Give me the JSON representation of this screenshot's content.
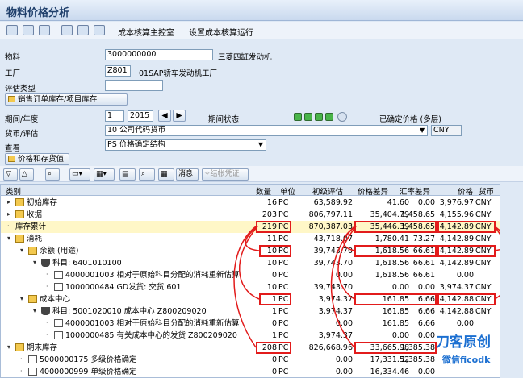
{
  "window": {
    "title": "物料价格分析"
  },
  "toolbar": {
    "master_label": "成本核算主控室",
    "settings_label": "设置成本核算运行"
  },
  "form": {
    "material_label": "物料",
    "material_value": "3000000000",
    "material_desc": "三菱四缸发动机",
    "plant_label": "工厂",
    "plant_value": "Z801",
    "plant_desc": "01SAP轿车发动机工厂",
    "valuation_type_label": "评估类型",
    "valuation_type_value": "",
    "sales_order_button": "销售订单库存/项目库存",
    "period_label": "期间/年度",
    "period_value": "1",
    "year_value": "2015",
    "period_status_label": "期间状态",
    "period_status_text": "已确定价格 (多层)",
    "currency_label": "货币/评估",
    "currency_value": "10 公司代码货币",
    "currency_code": "CNY",
    "view_label": "查看",
    "view_value": "PS 价格确定结构",
    "price_stock_button": "价格和存货值"
  },
  "gridbar": {
    "message_label": "消息",
    "close_voucher_label": "结帐凭证"
  },
  "columns": {
    "category": "类别",
    "quantity": "数量",
    "unit": "单位",
    "initial": "初级评估",
    "price_diff": "价格差异",
    "fx_diff": "汇率差异",
    "price": "价格",
    "currency": "货币"
  },
  "rows": [
    {
      "name": "初始库存",
      "qty": "16",
      "unit": "PC",
      "initial": "63,589.92",
      "price_diff": "41.60",
      "fx_diff": "0.00",
      "price": "3,976.97",
      "cur": "CNY"
    },
    {
      "name": "收据",
      "qty": "203",
      "unit": "PC",
      "initial": "806,797.11",
      "price_diff": "35,404.79",
      "fx_diff": "1,458.65",
      "price": "4,155.96",
      "cur": "CNY"
    },
    {
      "name": "库存累计",
      "qty": "219",
      "unit": "PC",
      "initial": "870,387.03",
      "price_diff": "35,446.39",
      "fx_diff": "1,458.65",
      "price": "4,142.89",
      "cur": "CNY"
    },
    {
      "name": "消耗",
      "qty": "11",
      "unit": "PC",
      "initial": "43,718.07",
      "price_diff": "1,780.41",
      "fx_diff": "73.27",
      "price": "4,142.89",
      "cur": "CNY"
    },
    {
      "name": "余额 (用途)",
      "qty": "10",
      "unit": "PC",
      "initial": "39,743.70",
      "price_diff": "1,618.56",
      "fx_diff": "66.61",
      "price": "4,142.89",
      "cur": "CNY"
    },
    {
      "name": "科目: 6401010100",
      "qty": "10",
      "unit": "PC",
      "initial": "39,743.70",
      "price_diff": "1,618.56",
      "fx_diff": "66.61",
      "price": "4,142.89",
      "cur": "CNY"
    },
    {
      "name": "4000001003 相对于原始科目分配的消耗重新估算",
      "qty": "0",
      "unit": "PC",
      "initial": "0.00",
      "price_diff": "1,618.56",
      "fx_diff": "66.61",
      "price": "0.00",
      "cur": ""
    },
    {
      "name": "1000000484 GD发货: 交货 601",
      "qty": "10",
      "unit": "PC",
      "initial": "39,743.70",
      "price_diff": "0.00",
      "fx_diff": "0.00",
      "price": "3,974.37",
      "cur": "CNY"
    },
    {
      "name": "成本中心",
      "qty": "1",
      "unit": "PC",
      "initial": "3,974.37",
      "price_diff": "161.85",
      "fx_diff": "6.66",
      "price": "4,142.88",
      "cur": "CNY"
    },
    {
      "name": "科目: 5001020010 成本中心 Z800209020",
      "qty": "1",
      "unit": "PC",
      "initial": "3,974.37",
      "price_diff": "161.85",
      "fx_diff": "6.66",
      "price": "4,142.88",
      "cur": "CNY"
    },
    {
      "name": "4000001003 相对于原始科目分配的消耗重新估算",
      "qty": "0",
      "unit": "PC",
      "initial": "0.00",
      "price_diff": "161.85",
      "fx_diff": "6.66",
      "price": "0.00",
      "cur": ""
    },
    {
      "name": "1000000485 有关成本中心的发货 Z800209020",
      "qty": "1",
      "unit": "PC",
      "initial": "3,974.37",
      "price_diff": "0.00",
      "fx_diff": "0.00",
      "price": "",
      "cur": ""
    },
    {
      "name": "期末库存",
      "qty": "208",
      "unit": "PC",
      "initial": "826,668.96",
      "price_diff": "33,665.98",
      "fx_diff": "1,385.38",
      "price": "",
      "cur": ""
    },
    {
      "name": "5000000175 多级价格确定",
      "qty": "0",
      "unit": "PC",
      "initial": "0.00",
      "price_diff": "17,331.52",
      "fx_diff": "1,385.38",
      "price": "",
      "cur": ""
    },
    {
      "name": "4000000999 单级价格确定",
      "qty": "0",
      "unit": "PC",
      "initial": "0.00",
      "price_diff": "16,334.46",
      "fx_diff": "0.00",
      "price": "",
      "cur": ""
    }
  ],
  "watermark": {
    "line1": "刀客原创",
    "line2": "微信ficodk"
  },
  "colors": {
    "highlight": "#fff7c7",
    "annotation_red": "#e21b1b",
    "status_green": "#49b549"
  }
}
